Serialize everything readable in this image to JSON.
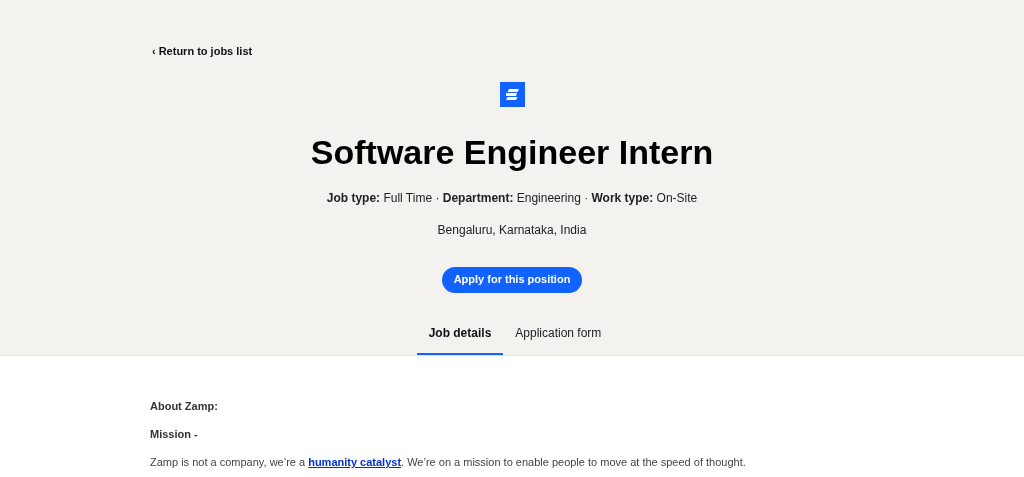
{
  "back_link": {
    "icon": "‹",
    "label": "Return to jobs list"
  },
  "title": "Software Engineer Intern",
  "meta": "**Job type:** Full Time · **Department:** Engineering · **Work type:** On-Site",
  "location": "Bengaluru, Karnataka, India",
  "apply_button": "Apply for this position",
  "tabs": [
    {
      "label": "Job details",
      "selected": true
    },
    {
      "label": "Application form",
      "selected": false
    }
  ],
  "content": [
    {
      "kind": "heading",
      "text": "About Zamp:"
    },
    {
      "kind": "heading",
      "text": "Mission -"
    },
    {
      "kind": "paragraph",
      "before": "Zamp is not a company, we’re a ",
      "link": "humanity catalyst",
      "after": ". We’re on a mission to enable people to move at the speed of thought."
    }
  ]
}
